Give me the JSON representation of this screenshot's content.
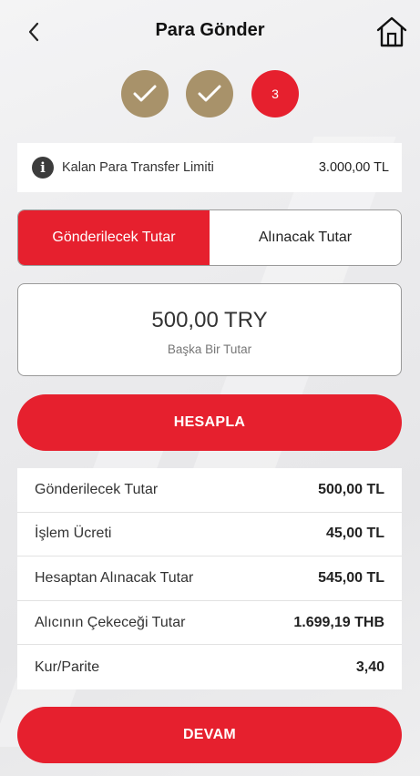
{
  "header": {
    "title": "Para Gönder"
  },
  "steps": {
    "current_label": "3"
  },
  "limit": {
    "label": "Kalan Para Transfer Limiti",
    "value": "3.000,00 TL",
    "icon": "info-icon"
  },
  "toggle": {
    "option_send": "Gönderilecek Tutar",
    "option_receive": "Alınacak Tutar"
  },
  "amount": {
    "value": "500,00 TRY",
    "subtitle": "Başka Bir Tutar"
  },
  "calculate_button": "HESAPLA",
  "summary": [
    {
      "label": "Gönderilecek Tutar",
      "value": "500,00 TL"
    },
    {
      "label": "İşlem Ücreti",
      "value": "45,00 TL"
    },
    {
      "label": "Hesaptan Alınacak Tutar",
      "value": "545,00 TL"
    },
    {
      "label": "Alıcının Çekeceği Tutar",
      "value": "1.699,19 THB"
    },
    {
      "label": "Kur/Parite",
      "value": "3,40"
    }
  ],
  "continue_button": "DEVAM",
  "colors": {
    "accent_red": "#e6202e",
    "step_done_gold": "#a8926a"
  }
}
